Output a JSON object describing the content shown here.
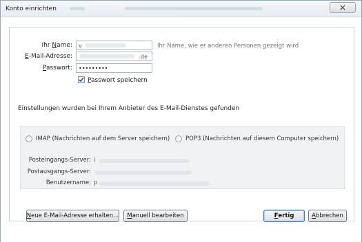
{
  "window": {
    "title": "Konto einrichten"
  },
  "form": {
    "name_label_pre": "Ihr ",
    "name_label_ul": "N",
    "name_label_post": "ame:",
    "name_value": "v",
    "name_hint": "Ihr Name, wie er anderen Personen gezeigt wird",
    "email_label_ul": "E",
    "email_label_post": "-Mail-Adresse:",
    "email_value_suffix": ".de",
    "password_label_ul": "P",
    "password_label_post": "asswort:",
    "password_value": "•••••••••",
    "save_password_ul": "P",
    "save_password_post": "asswort speichern",
    "save_password_checked": true
  },
  "status_text": "Einstellungen wurden bei Ihrem Anbieter des E-Mail-Dienstes gefunden",
  "server_group": {
    "imap_label": "IMAP (Nachrichten auf dem Server speichern)",
    "pop3_label": "POP3 (Nachrichten auf diesem Computer speichern)",
    "incoming_label": "Posteingangs-Server:",
    "incoming_value": "i",
    "outgoing_label": "Postausgangs-Server:",
    "username_label": "Benutzername:",
    "username_value": "p"
  },
  "buttons": {
    "new_email_ul": "N",
    "new_email_post": "eue E-Mail-Adresse erhalten...",
    "manual_ul": "M",
    "manual_post": "anuell bearbeiten",
    "done_ul": "F",
    "done_post": "ertig",
    "cancel_ul": "A",
    "cancel_post": "bbrechen"
  }
}
